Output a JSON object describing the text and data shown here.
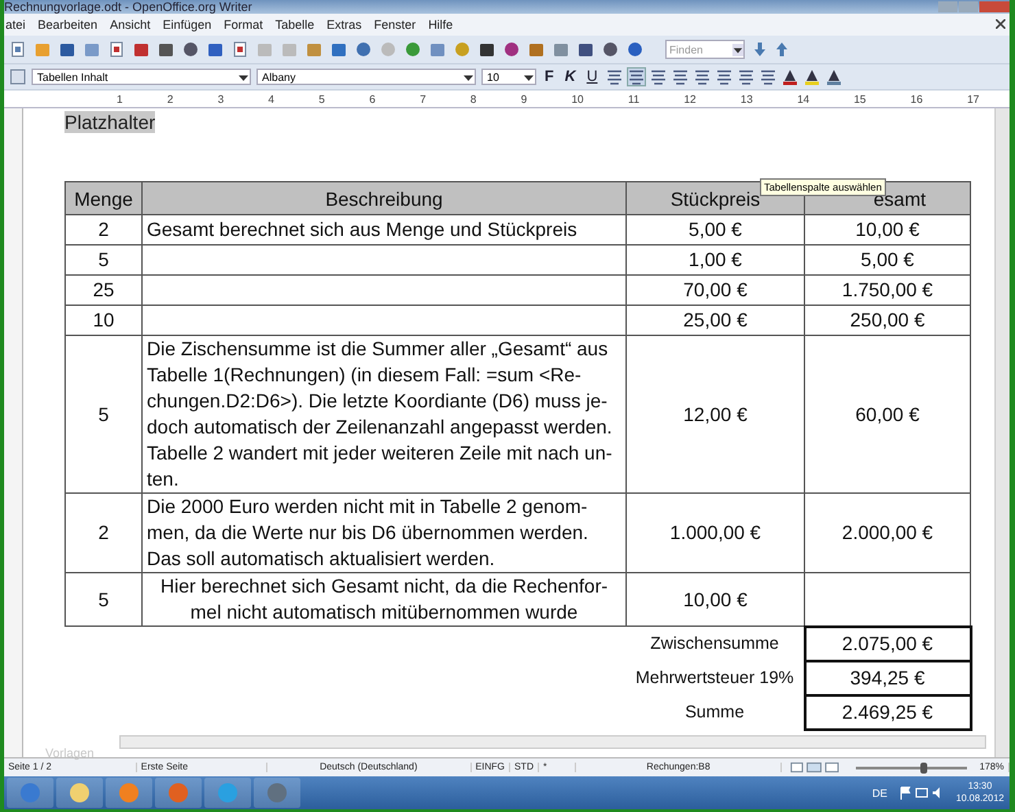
{
  "window": {
    "title": "Rechnungvorlage.odt - OpenOffice.org Writer"
  },
  "menu": [
    "atei",
    "Bearbeiten",
    "Ansicht",
    "Einfügen",
    "Format",
    "Tabelle",
    "Extras",
    "Fenster",
    "Hilfe"
  ],
  "formatting": {
    "style": "Tabellen Inhalt",
    "font": "Albany",
    "size": "10",
    "bold_label": "F",
    "italic_label": "K",
    "underline_label": "U"
  },
  "find": {
    "placeholder": "Finden"
  },
  "ruler": [
    "1",
    "2",
    "3",
    "4",
    "5",
    "6",
    "7",
    "8",
    "9",
    "10",
    "11",
    "12",
    "13",
    "14",
    "15",
    "16",
    "17"
  ],
  "document": {
    "placeholder_field": "Platzhalter",
    "tooltip": "Tabellenspalte auswählen",
    "table": {
      "columns": [
        "Menge",
        "Beschreibung",
        "Stückpreis",
        "esamt"
      ],
      "rows": [
        {
          "kind": "plain",
          "cells": [
            "2",
            "Gesamt berechnet sich aus Menge und Stückpreis",
            "5,00 €",
            "10,00 €"
          ]
        },
        {
          "kind": "plain",
          "cells": [
            "5",
            "",
            "1,00 €",
            "5,00 €"
          ]
        },
        {
          "kind": "plain",
          "cells": [
            "25",
            "",
            "70,00 €",
            "1.750,00 €"
          ]
        },
        {
          "kind": "plain",
          "cells": [
            "10",
            "",
            "25,00 €",
            "250,00 €"
          ]
        },
        {
          "kind": "plain",
          "cells": [
            "5",
            "Die Zischensumme ist die Summer aller „Gesamt“ aus\nTabelle 1(Rechnungen) (in diesem Fall: =sum <Re-\nchungen.D2:D6>). Die letzte Koordiante (D6) muss je-\ndoch automatisch der Zeilenanzahl angepasst werden.\nTabelle 2 wandert mit jeder weiteren Zeile mit nach un-\nten.",
            "12,00 €",
            "60,00 €"
          ]
        },
        {
          "kind": "plain",
          "cells": [
            "2",
            "Die 2000 Euro werden nicht mit in Tabelle 2 genom-\nmen, da die Werte nur bis D6 übernommen werden.\nDas soll automatisch aktualisiert werden.",
            "1.000,00 €",
            "2.000,00 €"
          ]
        },
        {
          "kind": "centered",
          "cells": [
            "5",
            "Hier berechnet sich Gesamt nicht, da die Rechenfor-\nmel nicht automatisch mitübernommen wurde",
            "10,00 €",
            ""
          ]
        }
      ]
    },
    "summary": [
      {
        "label": "Zwischensumme",
        "value": "2.075,00 €"
      },
      {
        "label": "Mehrwertsteuer 19%",
        "value": "394,25 €"
      },
      {
        "label": "Summe",
        "value": "2.469,25 €"
      }
    ],
    "styles_hint": "Vorlagen"
  },
  "status_bar": {
    "page": "Seite 1 / 2",
    "page_style": "Erste Seite",
    "language": "Deutsch (Deutschland)",
    "insert_mode": "EINFG",
    "selection_mode": "STD",
    "modified": "*",
    "cell": "Rechungen:B8",
    "zoom": {
      "level": 0.6,
      "reading": "178%"
    }
  },
  "taskbar": {
    "language": "DE",
    "time": "13:30",
    "date": "10.08.2012"
  }
}
